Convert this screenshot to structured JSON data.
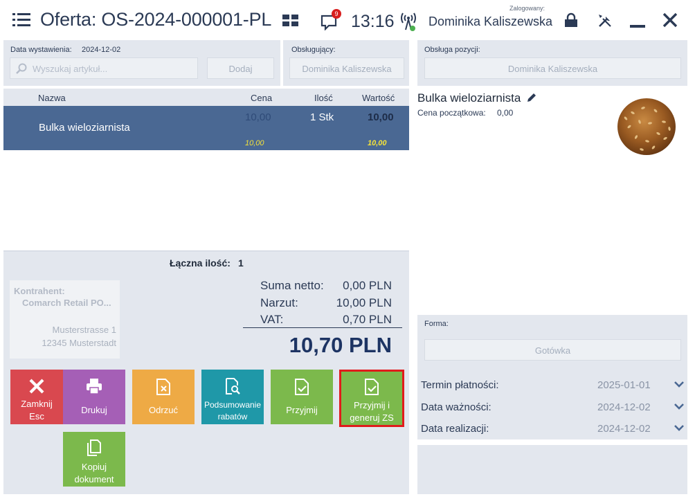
{
  "header": {
    "title": "Oferta: OS-2024-000001-PL",
    "notification_count": "9",
    "time": "13:16",
    "logged_in_label": "Zalogowany:",
    "user_name": "Dominika Kaliszewska"
  },
  "doc_panel": {
    "issue_date_label": "Data wystawienia:",
    "issue_date_value": "2024-12-02",
    "search_placeholder": "Wyszukaj artykuł...",
    "add_label": "Dodaj"
  },
  "handler_panel": {
    "label": "Obsługujący:",
    "value": "Dominika Kaliszewska"
  },
  "position_handler_panel": {
    "label": "Obsługa pozycji:",
    "value": "Dominika Kaliszewska"
  },
  "table": {
    "headers": [
      "Nazwa",
      "Cena",
      "Ilość",
      "Wartość"
    ],
    "rows": [
      {
        "name": "Bulka wieloziarnista",
        "price": "10,00",
        "quantity": "1 Stk",
        "value": "10,00",
        "price_sub": "10,00",
        "value_sub": "10,00"
      }
    ],
    "total_qty_label": "Łączna ilość:",
    "total_qty_value": "1"
  },
  "contractor": {
    "label": "Kontrahent:",
    "name": "Comarch Retail PO...",
    "street": "Musterstrasse 1",
    "city": "12345 Musterstadt"
  },
  "summary": {
    "net_label": "Suma netto:",
    "net_value": "0,00 PLN",
    "markup_label": "Narzut:",
    "markup_value": "10,00 PLN",
    "vat_label": "VAT:",
    "vat_value": "0,70 PLN",
    "total": "10,70 PLN"
  },
  "actions": {
    "close_line1": "Zamknij",
    "close_line2": "Esc",
    "print": "Drukuj",
    "reject": "Odrzuć",
    "discounts_line1": "Podsumowanie",
    "discounts_line2": "rabatów",
    "accept": "Przyjmij",
    "accept_gen_line1": "Przyjmij i",
    "accept_gen_line2": "generuj ZS",
    "copy_line1": "Kopiuj",
    "copy_line2": "dokument"
  },
  "product": {
    "name": "Bulka wieloziarnista",
    "initial_price_label": "Cena początkowa:",
    "initial_price_value": "0,00"
  },
  "payment": {
    "form_label": "Forma:",
    "form_value": "Gotówka",
    "due_label": "Termin płatności:",
    "due_value": "2025-01-01",
    "validity_label": "Data ważności:",
    "validity_value": "2024-12-02",
    "realization_label": "Data realizacji:",
    "realization_value": "2024-12-02"
  },
  "colors": {
    "accent_dark": "#2b3a55",
    "selected_row": "#4a6893",
    "close_tile": "#d9484f",
    "print_tile": "#a55fb6",
    "reject_tile": "#eeaa45",
    "discount_tile": "#1f98a8",
    "accept_tile": "#7cb94c",
    "highlight_border": "#e01b1b"
  }
}
